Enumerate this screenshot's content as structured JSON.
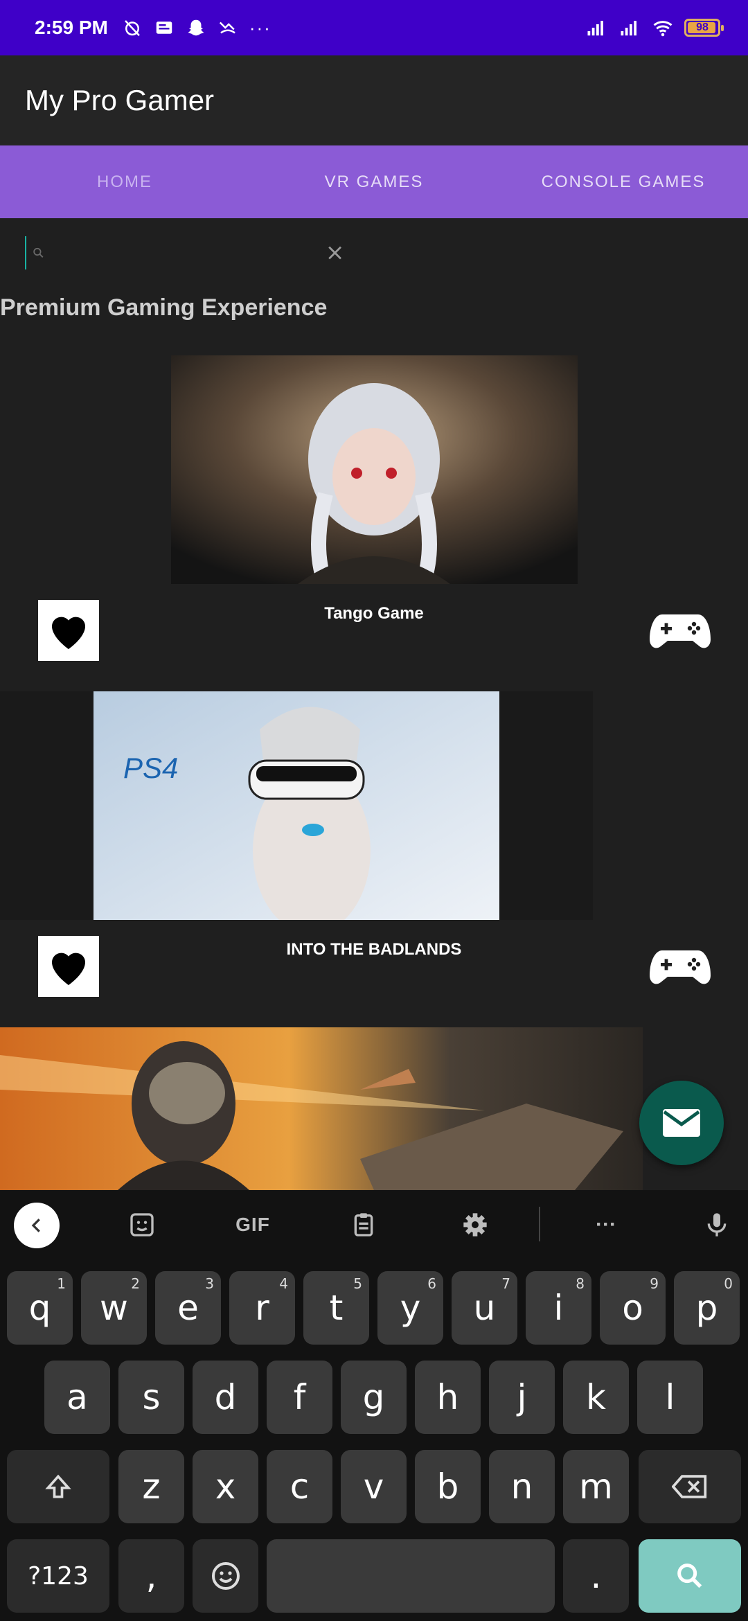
{
  "status_bar": {
    "time": "2:59 PM",
    "battery": "98",
    "more": "···"
  },
  "app": {
    "title": "My Pro Gamer"
  },
  "tabs": [
    {
      "label": "HOME"
    },
    {
      "label": "VR GAMES"
    },
    {
      "label": "CONSOLE GAMES"
    }
  ],
  "search": {
    "value": "",
    "placeholder": ""
  },
  "section_title": "Premium Gaming Experience",
  "games": [
    {
      "name": "Tango Game"
    },
    {
      "name": "INTO THE BADLANDS",
      "image_text": "PS4"
    },
    {
      "name": ""
    }
  ],
  "keyboard": {
    "toolbar": {
      "gif": "GIF",
      "more": "···"
    },
    "row1": [
      {
        "key": "q",
        "hint": "1"
      },
      {
        "key": "w",
        "hint": "2"
      },
      {
        "key": "e",
        "hint": "3"
      },
      {
        "key": "r",
        "hint": "4"
      },
      {
        "key": "t",
        "hint": "5"
      },
      {
        "key": "y",
        "hint": "6"
      },
      {
        "key": "u",
        "hint": "7"
      },
      {
        "key": "i",
        "hint": "8"
      },
      {
        "key": "o",
        "hint": "9"
      },
      {
        "key": "p",
        "hint": "0"
      }
    ],
    "row2": [
      "a",
      "s",
      "d",
      "f",
      "g",
      "h",
      "j",
      "k",
      "l"
    ],
    "row3": [
      "z",
      "x",
      "c",
      "v",
      "b",
      "n",
      "m"
    ],
    "row4": {
      "symbols": "?123",
      "comma": ",",
      "period": "."
    }
  },
  "colors": {
    "status_bar": "#3f00c8",
    "tab_bar": "#8b5bd6",
    "fab": "#0a5a4d",
    "search_key": "#7fcac1"
  }
}
